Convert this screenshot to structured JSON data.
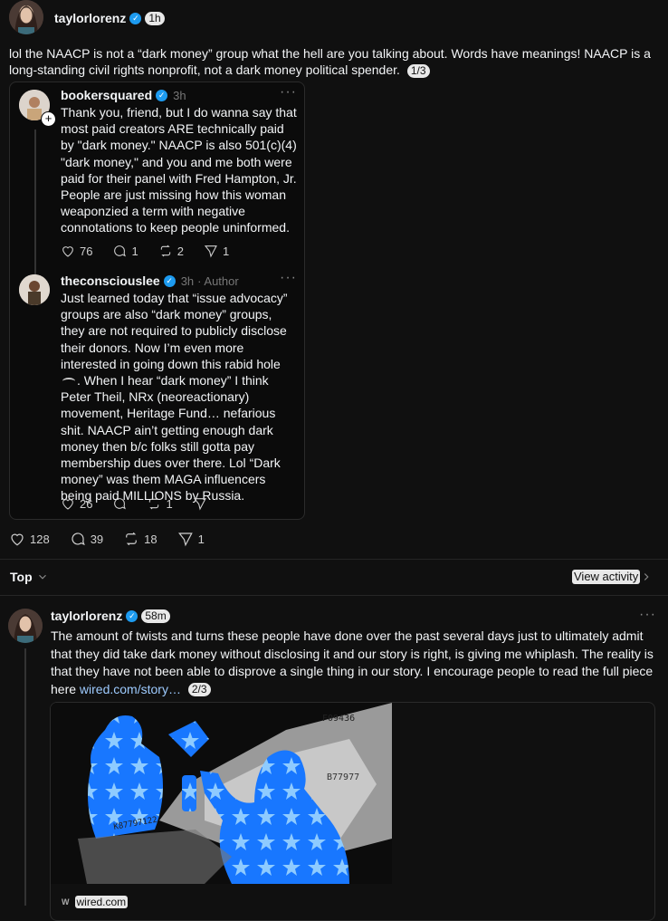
{
  "post1": {
    "username": "taylorlorenz",
    "time": "1h",
    "text": "lol the NAACP is not a “dark money” group what the hell are you talking about. Words have meanings! NAACP is a long-standing civil rights nonprofit, not a dark money political spender.",
    "thread_index": "1/3",
    "quote_reply1": {
      "username": "bookersquared",
      "time": "3h",
      "text": "Thank you, friend, but I do wanna say that most paid creators ARE technically paid by \"dark money.\" NAACP is also 501(c)(4) \"dark money,\" and you and me both were paid for their panel with Fred Hampton, Jr. People are just missing how this woman weaponzied a term with negative connotations to keep people uninformed.",
      "likes": "76",
      "replies": "1",
      "reposts": "2",
      "shares": "1"
    },
    "quote_reply2": {
      "username": "theconsciouslee",
      "time": "3h",
      "author_label": "· Author",
      "text_before_emoji": "Just learned today that “issue advocacy” groups are also “dark money” groups, they are not required to publicly disclose their donors. Now I’m even more interested in going down this rabid hole",
      "text_after_emoji": ". When I hear “dark money” I think Peter Theil, NRx (neoreactionary) movement, Heritage Fund… nefarious shit. NAACP ain’t getting enough dark money then b/c folks still gotta pay membership dues over there. Lol “Dark money” was them MAGA influencers being paid MILLIONS by Russia.",
      "likes": "26",
      "reposts": "1"
    },
    "likes": "128",
    "replies": "39",
    "reposts": "18",
    "shares": "1"
  },
  "sort_bar": {
    "label": "Top",
    "activity_label": "View activity"
  },
  "post2": {
    "username": "taylorlorenz",
    "time": "58m",
    "text": "The amount of twists and turns these people have done over the past several days just to ultimately admit that they did take dark money without disclosing it and our story is right, is giving me whiplash. The reality is that they have not been able to disprove a single thing in our story. I encourage people to read the full piece here",
    "link": "wired.com/story…",
    "thread_index": "2/3",
    "link_card_domain": "wired.com"
  },
  "icons": [
    "heart-icon",
    "comment-icon",
    "repost-icon",
    "share-icon",
    "chevron-down-icon",
    "chevron-right-icon",
    "more-icon",
    "plus-icon",
    "verified-icon"
  ]
}
